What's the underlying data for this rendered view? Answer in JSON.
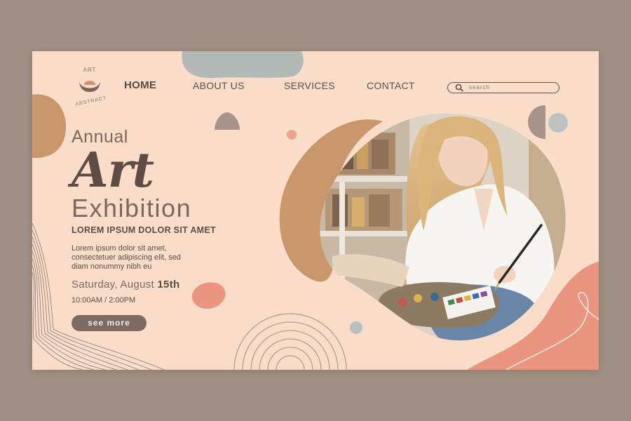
{
  "logo": {
    "top_text": "ART",
    "bottom_text": "ABSTRACT"
  },
  "nav": {
    "home": "HOME",
    "about": "ABOUT US",
    "services": "SERVICES",
    "contact": "CONTACT"
  },
  "search": {
    "placeholder": "search"
  },
  "hero": {
    "annual": "Annual",
    "art": "Art",
    "exhibition": "Exhibition",
    "subheading": "LOREM IPSUM DOLOR SIT AMET",
    "body_lines": [
      "Lorem ipsum dolor sit amet,",
      "consectetuer adipiscing elit, sed",
      "diam nonummy nibh eu"
    ],
    "date_prefix": "Saturday, August ",
    "date_day": "15th",
    "time": "10:00AM / 2:00PM",
    "cta": "see more"
  },
  "colors": {
    "page_bg": "#a08f84",
    "card_bg": "#f9ddc9",
    "text_dark": "#5e4c45",
    "accent_tan": "#c9976b",
    "accent_coral": "#e8907a",
    "accent_grey": "#b3b9b6"
  }
}
